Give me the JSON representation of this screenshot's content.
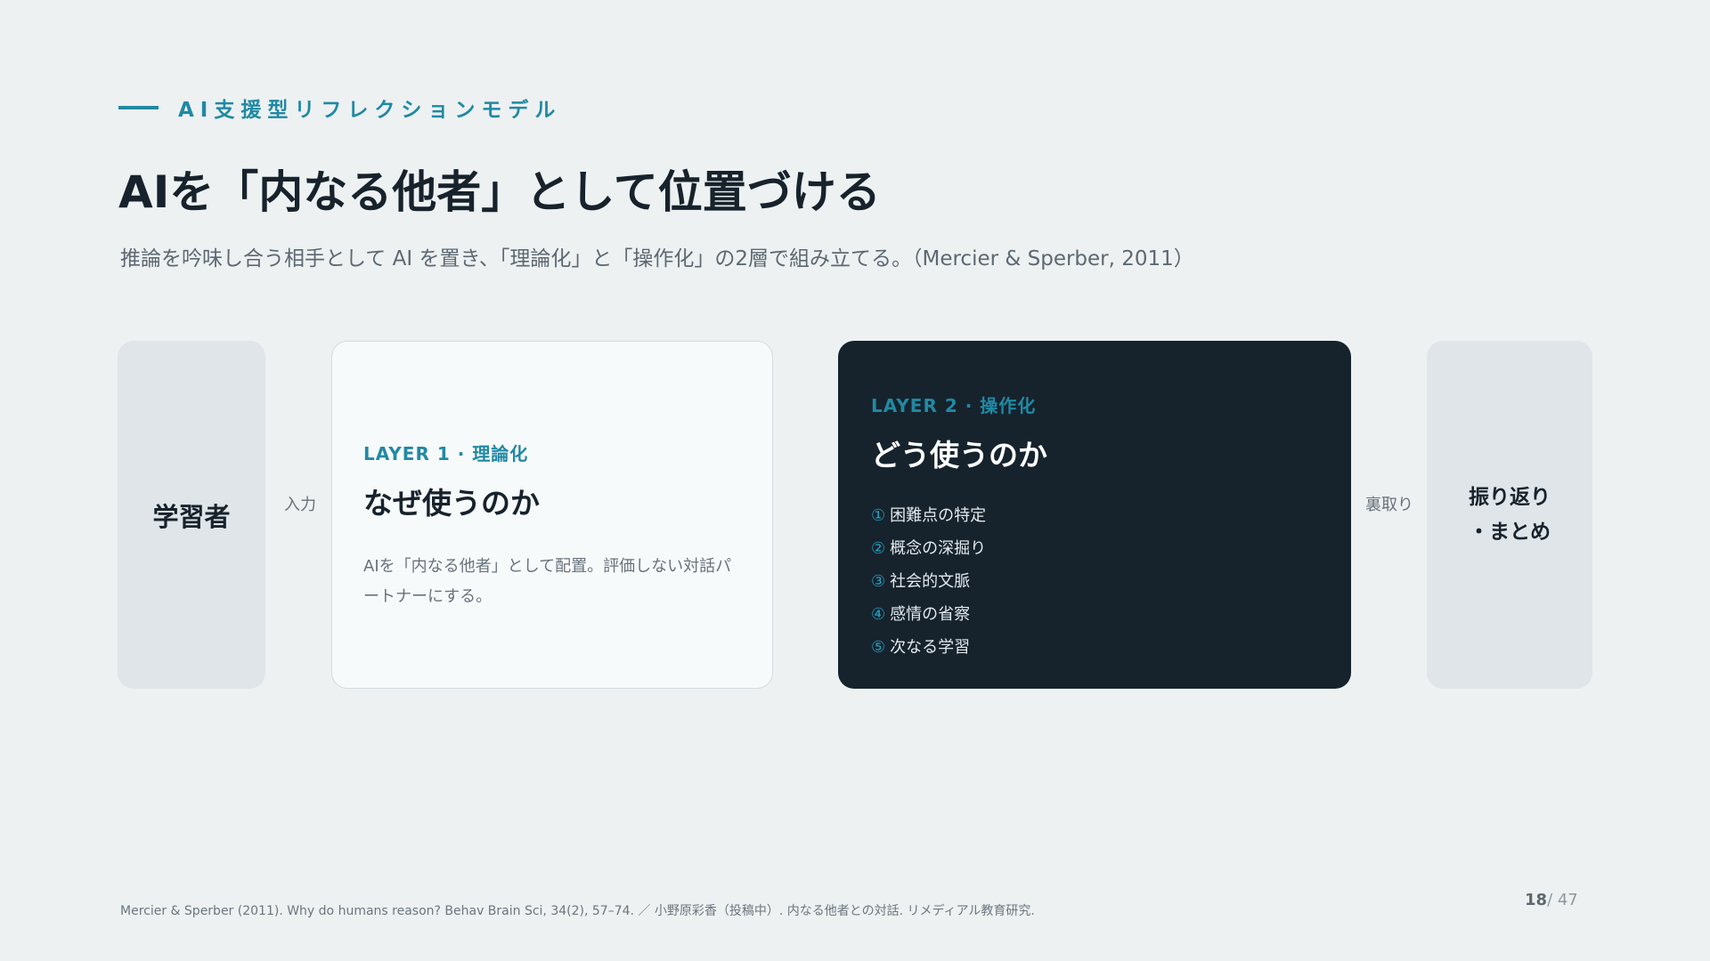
{
  "header": {
    "section_label": "AI支援型リフレクションモデル",
    "title": "AIを「内なる他者」として位置づける",
    "subtitle": "推論を吟味し合う相手として AI を置き、「理論化」と「操作化」の2層で組み立てる。（Mercier & Sperber, 2011）"
  },
  "diagram": {
    "learner": {
      "label": "学習者"
    },
    "input_label": "入力",
    "layer1": {
      "tag": "LAYER 1 · 理論化",
      "heading": "なぜ使うのか",
      "body": "AIを「内なる他者」として配置。評価しない対話パートナーにする。"
    },
    "layer2": {
      "tag": "LAYER 2 · 操作化",
      "heading": "どう使うのか",
      "steps": [
        {
          "number": "①",
          "label": "困難点の特定"
        },
        {
          "number": "②",
          "label": "概念の深掘り"
        },
        {
          "number": "③",
          "label": "社会的文脈"
        },
        {
          "number": "④",
          "label": "感情の省察"
        },
        {
          "number": "⑤",
          "label": "次なる学習"
        }
      ]
    },
    "verify_label": "裏取り",
    "summary": {
      "line1": "振り返り",
      "line2": "・まとめ"
    }
  },
  "footer": {
    "citation": "Mercier & Sperber (2011). Why do humans reason? Behav Brain Sci, 34(2), 57–74. ／ 小野原彩香（投稿中）. 内なる他者との対話. リメディアル教育研究.",
    "page_current": "18",
    "page_separator": "/ 47"
  },
  "colors": {
    "accent": "#2189a3",
    "dark_panel": "#16232d",
    "background": "#edf1f2",
    "side_panel": "#dfe5e8"
  }
}
